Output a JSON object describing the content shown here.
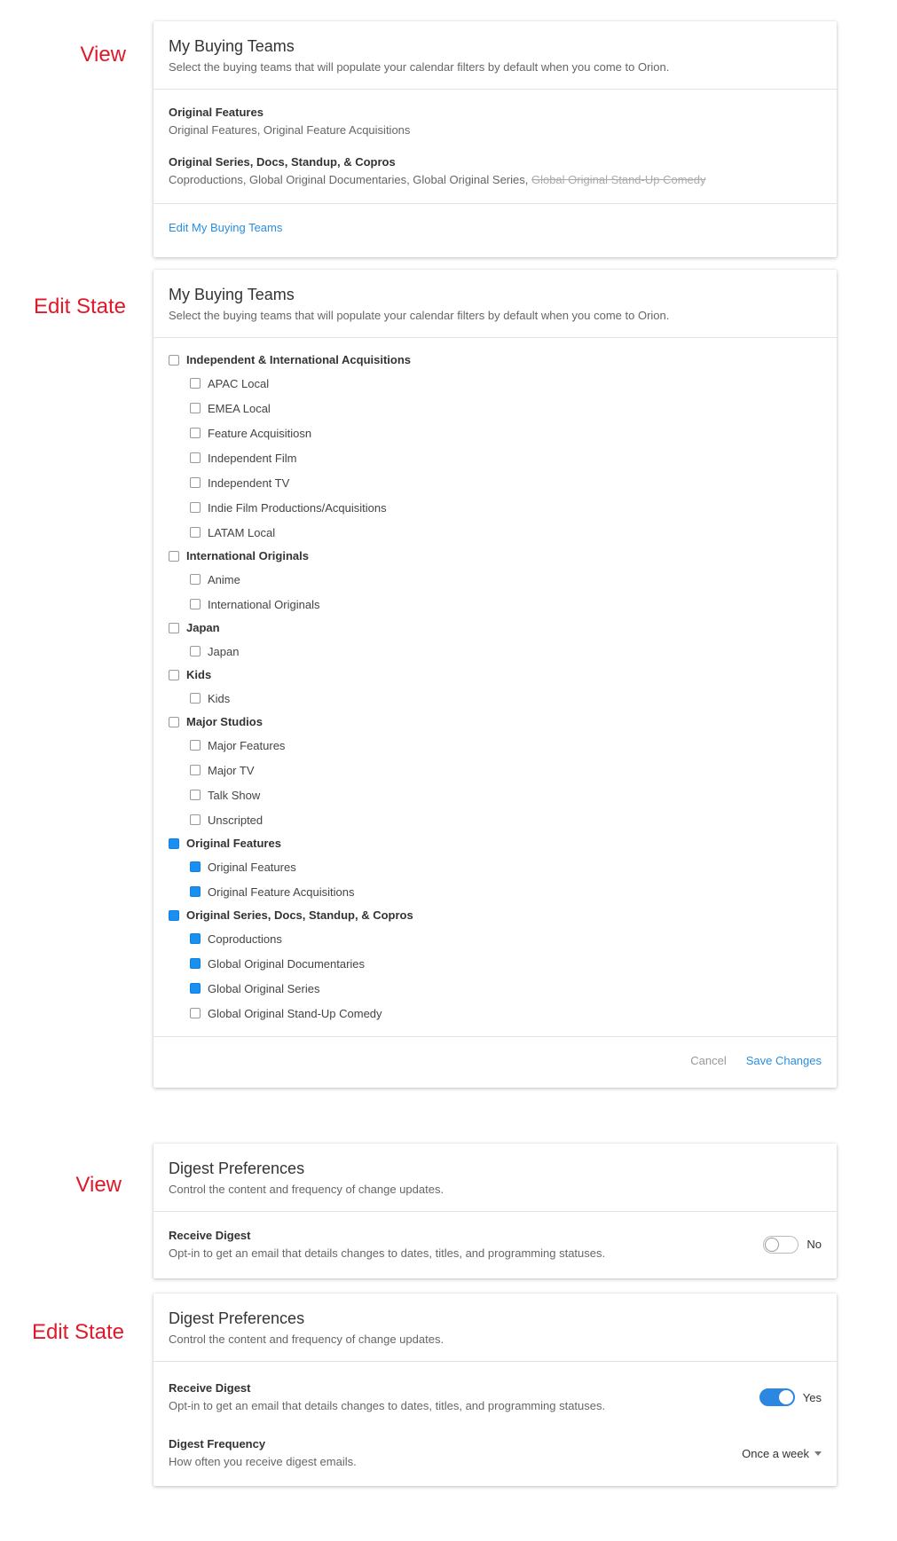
{
  "labels": {
    "view1": "View",
    "edit1": "Edit State",
    "view2": "View",
    "edit2": "Edit State"
  },
  "buying_view": {
    "title": "My Buying Teams",
    "subtitle": "Select the buying teams that will populate your calendar filters by default when you come to Orion.",
    "teams": [
      {
        "name": "Original Features",
        "list": "Original Features, Original Feature Acquisitions",
        "struck": ""
      },
      {
        "name": "Original Series, Docs, Standup, & Copros",
        "list": "Coproductions, Global Original Documentaries, Global Original Series, ",
        "struck": "Global Original Stand-Up Comedy"
      }
    ],
    "edit_link": "Edit My Buying Teams"
  },
  "buying_edit": {
    "title": "My Buying Teams",
    "subtitle": "Select the buying teams that will populate your calendar filters by default when you come to Orion.",
    "groups": [
      {
        "name": "Independent & International Acquisitions",
        "checked": false,
        "items": [
          {
            "label": "APAC Local",
            "checked": false
          },
          {
            "label": "EMEA Local",
            "checked": false
          },
          {
            "label": "Feature Acquisitiosn",
            "checked": false
          },
          {
            "label": "Independent Film",
            "checked": false
          },
          {
            "label": "Independent TV",
            "checked": false
          },
          {
            "label": "Indie Film Productions/Acquisitions",
            "checked": false
          },
          {
            "label": "LATAM Local",
            "checked": false
          }
        ]
      },
      {
        "name": "International Originals",
        "checked": false,
        "items": [
          {
            "label": "Anime",
            "checked": false
          },
          {
            "label": "International Originals",
            "checked": false
          }
        ]
      },
      {
        "name": "Japan",
        "checked": false,
        "items": [
          {
            "label": "Japan",
            "checked": false
          }
        ]
      },
      {
        "name": "Kids",
        "checked": false,
        "items": [
          {
            "label": "Kids",
            "checked": false
          }
        ]
      },
      {
        "name": "Major Studios",
        "checked": false,
        "items": [
          {
            "label": "Major Features",
            "checked": false
          },
          {
            "label": "Major TV",
            "checked": false
          },
          {
            "label": "Talk Show",
            "checked": false
          },
          {
            "label": "Unscripted",
            "checked": false
          }
        ]
      },
      {
        "name": "Original Features",
        "checked": true,
        "items": [
          {
            "label": "Original Features",
            "checked": true
          },
          {
            "label": "Original Feature Acquisitions",
            "checked": true
          }
        ]
      },
      {
        "name": "Original Series, Docs, Standup, & Copros",
        "checked": true,
        "items": [
          {
            "label": "Coproductions",
            "checked": true
          },
          {
            "label": "Global Original Documentaries",
            "checked": true
          },
          {
            "label": "Global Original Series",
            "checked": true
          },
          {
            "label": "Global Original Stand-Up Comedy",
            "checked": false
          }
        ]
      }
    ],
    "cancel_label": "Cancel",
    "save_label": "Save Changes"
  },
  "digest_view": {
    "title": "Digest Preferences",
    "subtitle": "Control the content and frequency of change updates.",
    "receive_label": "Receive Digest",
    "receive_sub": "Opt-in to get an email that details changes to dates, titles, and programming statuses.",
    "toggle_state": "No"
  },
  "digest_edit": {
    "title": "Digest Preferences",
    "subtitle": "Control the content and frequency of change updates.",
    "receive_label": "Receive Digest",
    "receive_sub": "Opt-in to get an email that details changes to dates, titles, and programming statuses.",
    "toggle_state": "Yes",
    "frequency_label": "Digest Frequency",
    "frequency_sub": "How often you receive digest emails.",
    "frequency_value": "Once a week"
  },
  "colors": {
    "label_red": "#e0192a",
    "accent_blue": "#2a8ee0",
    "checkbox_blue": "#1890f2"
  }
}
